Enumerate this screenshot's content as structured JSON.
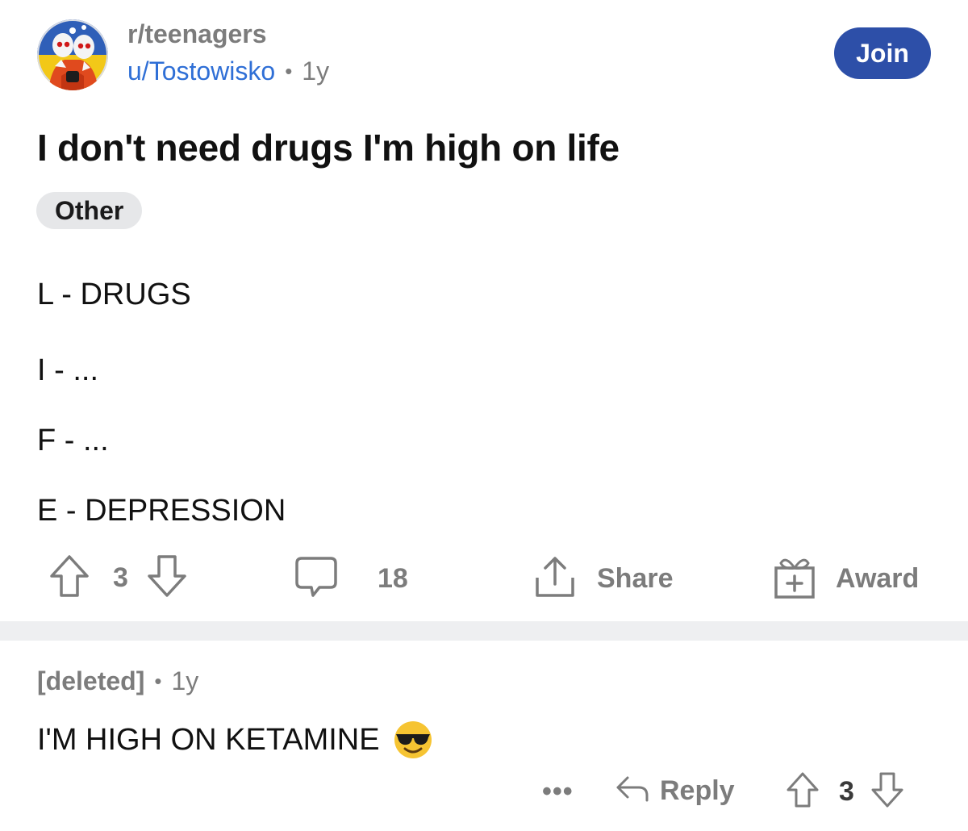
{
  "post": {
    "subreddit": "r/teenagers",
    "username": "u/Tostowisko",
    "separator": "•",
    "age": "1y",
    "join_label": "Join",
    "title": "I don't need drugs I'm high on life",
    "flair": "Other",
    "body_lines": [
      "L - DRUGS",
      "I - ...",
      "F - ...",
      "E - DEPRESSION"
    ],
    "votes": "3",
    "comments": "18",
    "share_label": "Share",
    "award_label": "Award"
  },
  "comment": {
    "author": "[deleted]",
    "separator": "•",
    "age": "1y",
    "body": "I'M HIGH ON KETAMINE",
    "emoji": "smiling-face-with-sunglasses-icon",
    "more_label": "•••",
    "reply_label": "Reply",
    "votes": "3"
  },
  "colors": {
    "join_button": "#2d4fa8",
    "username_link": "#2f6fd6",
    "muted_text": "#7c7c7c",
    "flair_bg": "#e6e7e9",
    "separator_bg": "#eeeff1"
  }
}
